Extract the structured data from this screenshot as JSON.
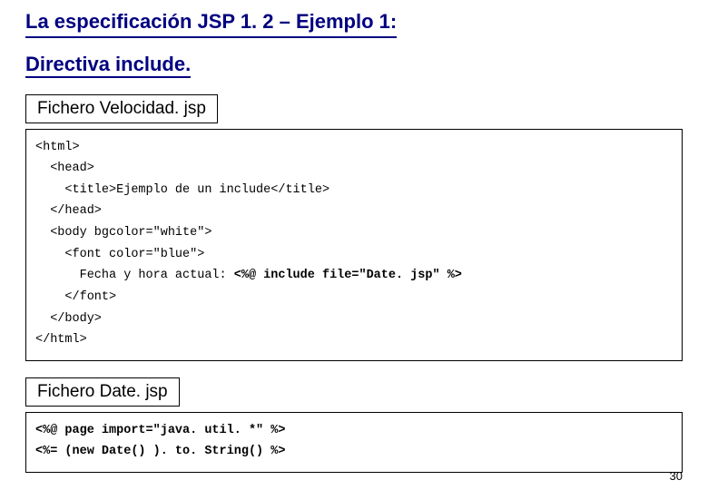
{
  "heading": {
    "line1": "La especificación JSP 1. 2 – Ejemplo 1:",
    "line2": "Directiva include."
  },
  "file1": {
    "label": "Fichero Velocidad. jsp",
    "code": {
      "l1": "<html>",
      "l2": "  <head>",
      "l3": "    <title>Ejemplo de un include</title>",
      "l4": "  </head>",
      "l5": "  <body bgcolor=\"white\">",
      "l6": "    <font color=\"blue\">",
      "l7a": "      Fecha y hora actual: ",
      "l7b": "<%@ include file=\"Date. jsp\" %>",
      "l8": "    </font>",
      "l9": "  </body>",
      "l10": "</html>"
    }
  },
  "file2": {
    "label": "Fichero Date. jsp",
    "code": {
      "l1": "<%@ page import=\"java. util. *\" %>",
      "l2": "<%= (new Date() ). to. String() %>"
    }
  },
  "page_number": "30"
}
